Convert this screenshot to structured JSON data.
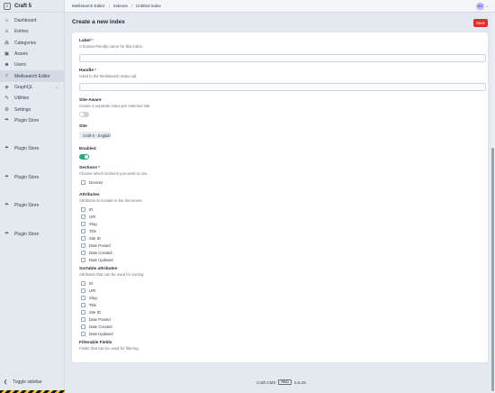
{
  "sidebar": {
    "site_icon": "C",
    "site_name": "Craft 5",
    "nav": [
      {
        "label": "Dashboard",
        "icon": "⌂"
      },
      {
        "label": "Entries",
        "icon": "≡"
      },
      {
        "label": "Categories",
        "icon": "⁂"
      },
      {
        "label": "Assets",
        "icon": "▣"
      },
      {
        "label": "Users",
        "icon": "☻"
      },
      {
        "label": "Meilisearch Editor",
        "icon": "⌕"
      },
      {
        "label": "GraphQL",
        "icon": "◈"
      },
      {
        "label": "Utilities",
        "icon": "✎"
      },
      {
        "label": "Settings",
        "icon": "⚙"
      },
      {
        "label": "Plugin Store",
        "icon": "☂"
      }
    ],
    "plugin_store_repeats": [
      "Plugin Store",
      "Plugin Store",
      "Plugin Store",
      "Plugin Store",
      "Plugin Store"
    ],
    "toggle_label": "Toggle sidebar",
    "toggle_icon": "❮"
  },
  "topbar": {
    "breadcrumbs": [
      "Meilisearch Editor",
      "Indexes",
      "Untitled index"
    ],
    "avatar_initials": "DO"
  },
  "page": {
    "title": "Create a new index",
    "save_label": "Save"
  },
  "form": {
    "label": {
      "label": "Label",
      "hint": "A human-friendly name for this index.",
      "value": ""
    },
    "handle": {
      "label": "Handle",
      "hint": "Used in the Meilisearch index uid.",
      "value": ""
    },
    "site_aware": {
      "label": "Site-Aware",
      "hint": "Create a separate index per selected site.",
      "on": false
    },
    "site": {
      "label": "Site",
      "selected": "Craft 5 - English"
    },
    "enabled": {
      "label": "Enabled",
      "on": true
    },
    "sections": {
      "label": "Sections",
      "hint": "Choose which sections you want to use.",
      "options": [
        "Devices"
      ]
    },
    "attributes": {
      "label": "Attributes",
      "hint": "Attributes to include in the document.",
      "options": [
        "ID",
        "URI",
        "Slug",
        "Title",
        "Site ID",
        "Date Posted",
        "Date Created",
        "Date Updated"
      ]
    },
    "sortable": {
      "label": "Sortable attributes",
      "hint": "Attributes that can be used for sorting.",
      "options": [
        "ID",
        "URI",
        "Slug",
        "Title",
        "Site ID",
        "Date Posted",
        "Date Created",
        "Date Updated"
      ]
    },
    "filterable": {
      "label": "Filterable Fields",
      "hint": "Fields that can be used for filtering."
    }
  },
  "footer": {
    "product": "Craft CMS",
    "edition": "PRO",
    "version": "5.6.25"
  },
  "colors": {
    "accent_red": "#e02e2a",
    "toggle_on": "#27ab83",
    "sidebar_bg": "#e4e9ef"
  }
}
